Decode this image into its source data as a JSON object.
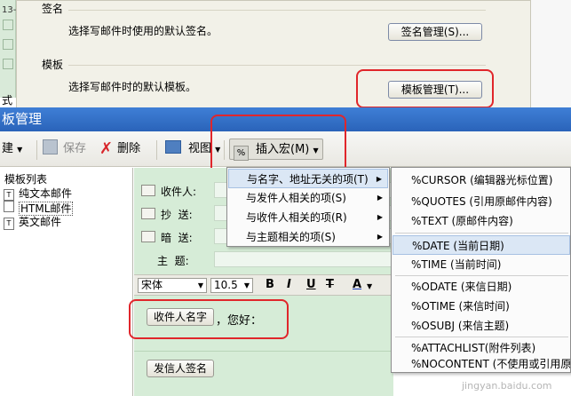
{
  "settings_dialog": {
    "signature_section_title": "签名",
    "signature_desc": "选择写邮件时使用的默认签名。",
    "signature_button": "签名管理(S)...",
    "template_section_title": "模板",
    "template_desc": "选择写邮件时的默认模板。",
    "template_button": "模板管理(T)...",
    "left_edge_text": "13-",
    "left_edge_text2": "式"
  },
  "window": {
    "title": "板管理"
  },
  "toolbar": {
    "new_label": "建",
    "save_label": "保存",
    "delete_label": "删除",
    "view_label": "视图",
    "insert_macro_label": "插入宏(M)"
  },
  "template_list": {
    "header": "模板列表",
    "items": [
      "纯文本邮件",
      "HTML邮件",
      "英文邮件"
    ]
  },
  "compose": {
    "to_label": "收件人:",
    "cc_label": "抄  送:",
    "bcc_label": "暗  送:",
    "subject_label": "主  题:",
    "font_value": "宋体",
    "size_value": "10.5",
    "bold": "B",
    "italic": "I",
    "underline": "U",
    "strike": "T",
    "font_color": "A",
    "body_button1": "收件人名字",
    "body_text": "，您好：",
    "body_button2": "发信人签名"
  },
  "macro_menu": {
    "items": [
      "与名字、地址无关的项(T)",
      "与发件人相关的项(S)",
      "与收件人相关的项(R)",
      "与主题相关的项(S)"
    ]
  },
  "submenu": {
    "items": [
      "%CURSOR (编辑器光标位置)",
      "%QUOTES (引用原邮件内容)",
      "%TEXT (原邮件内容)",
      "%DATE (当前日期)",
      "%TIME (当前时间)",
      "%ODATE (来信日期)",
      "%OTIME (来信时间)",
      "%OSUBJ (来信主题)",
      "%ATTACHLIST(附件列表)",
      "%NOCONTENT (不使用或引用原邮件"
    ],
    "watermark": "jingyan.baidu.com"
  },
  "colors": {
    "title_bar": "#2f6cc6",
    "highlight_red": "#e0262b",
    "editor_bg": "#d6ecd7",
    "menu_highlight": "#dbe7f5"
  }
}
